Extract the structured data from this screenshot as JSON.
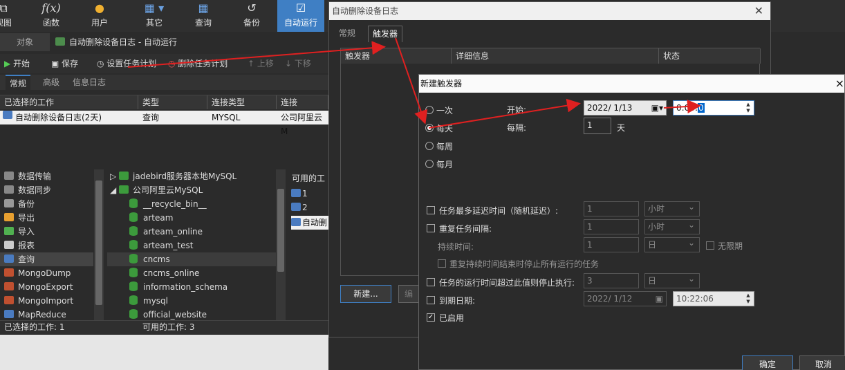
{
  "ribbon": {
    "items": [
      {
        "label": "视图",
        "icon": "view-icon"
      },
      {
        "label": "函数",
        "icon": "function-icon"
      },
      {
        "label": "用户",
        "icon": "user-icon"
      },
      {
        "label": "其它",
        "icon": "other-icon"
      },
      {
        "label": "查询",
        "icon": "query-icon"
      },
      {
        "label": "备份",
        "icon": "backup-icon"
      },
      {
        "label": "自动运行",
        "icon": "auto-run-icon",
        "active": true
      }
    ]
  },
  "main_tabs": {
    "objects": "对象",
    "current": "自动删除设备日志 - 自动运行"
  },
  "toolbar": {
    "start": "开始",
    "save": "保存",
    "set_schedule": "设置任务计划",
    "delete_schedule": "删除任务计划",
    "move_up": "上移",
    "move_down": "下移"
  },
  "sub_tabs": [
    "常规",
    "高级",
    "信息日志"
  ],
  "selected_table": {
    "headers": [
      "已选择的工作",
      "类型",
      "连接类型",
      "连接"
    ],
    "row": [
      "自动删除设备日志(2天)",
      "查询",
      "MYSQL",
      "公司阿里云M"
    ]
  },
  "left_nav": [
    "数据传输",
    "数据同步",
    "备份",
    "导出",
    "导入",
    "报表",
    "查询",
    "MongoDump",
    "MongoExport",
    "MongoImport",
    "MapReduce"
  ],
  "tree": {
    "connections": [
      "jadebird服务器本地MySQL",
      "公司阿里云MySQL"
    ],
    "databases": [
      "__recycle_bin__",
      "arteam",
      "arteam_online",
      "arteam_test",
      "cncms",
      "cncms_online",
      "information_schema",
      "mysql",
      "official_website"
    ]
  },
  "available": {
    "header": "可用的工",
    "items": [
      "1",
      "2",
      "自动删"
    ]
  },
  "status": {
    "selected": "已选择的工作: 1",
    "available": "可用的工作: 3"
  },
  "dialog1": {
    "title": "自动删除设备日志",
    "tabs": [
      "常规",
      "触发器"
    ],
    "headers": [
      "触发器",
      "详细信息",
      "状态"
    ],
    "new_button": "新建...",
    "other_button": "编"
  },
  "dialog2": {
    "title": "新建触发器",
    "close": "×",
    "freq": [
      "一次",
      "每天",
      "每周",
      "每月"
    ],
    "selected_freq": "每天",
    "start_label": "开始:",
    "start_date": "2022/  1/13",
    "start_time": "0:00:",
    "start_time_sel": "0",
    "interval_label": "每隔:",
    "interval_value": "1",
    "interval_unit": "天",
    "max_delay": {
      "label": "任务最多延迟时间（随机延迟）:",
      "value": "1",
      "unit": "小时"
    },
    "repeat": {
      "label": "重复任务间隔:",
      "value": "1",
      "unit": "小时"
    },
    "duration": {
      "label": "持续时间:",
      "value": "1",
      "unit": "日",
      "infinite": "无限期"
    },
    "stop_at_end": "重复持续时间结束时停止所有运行的任务",
    "stop_if_longer": {
      "label": "任务的运行时间超过此值则停止执行:",
      "value": "3",
      "unit": "日"
    },
    "expire": {
      "label": "到期日期:",
      "date": "2022/  1/12",
      "time": "10:22:06"
    },
    "enabled": "已启用",
    "ok": "确定",
    "cancel": "取消"
  },
  "accent": "#3f7fc4",
  "arrow_color": "#e02020"
}
